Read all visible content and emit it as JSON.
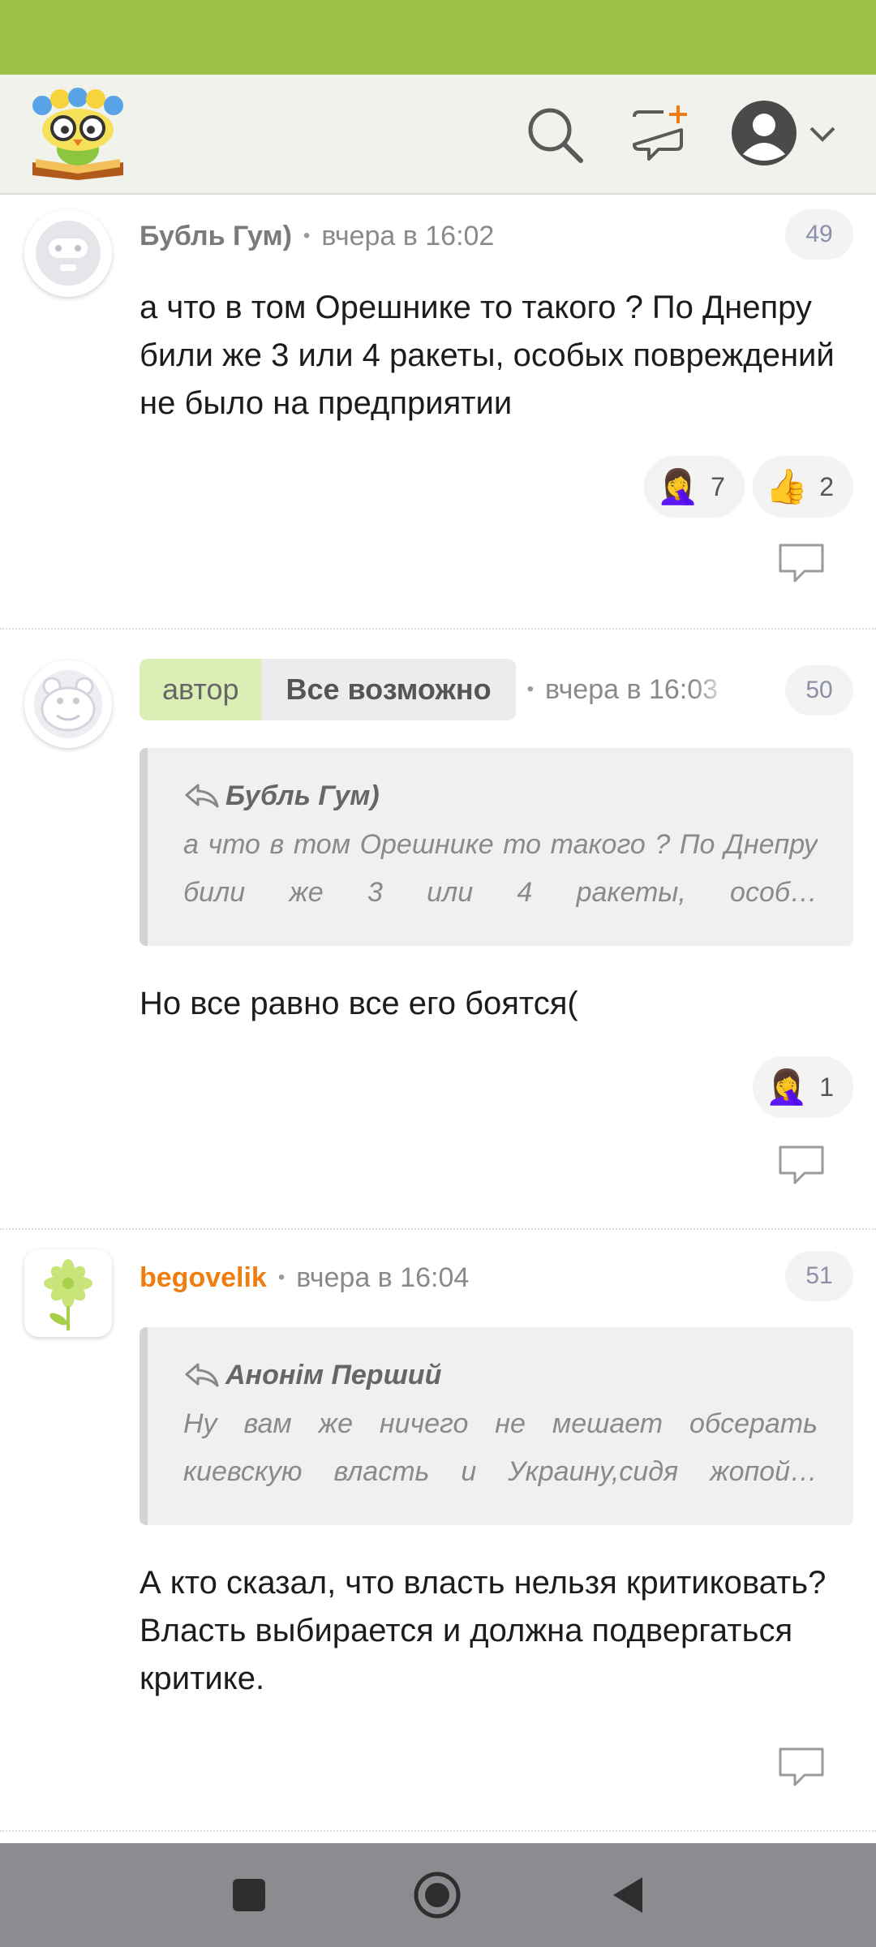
{
  "colors": {
    "status_bar": "#9dc146",
    "header_bg": "#f2f2ec",
    "accent_orange": "#f07d0f",
    "author_badge": "#dbeeb5",
    "nav_bar": "#8c8c90"
  },
  "header": {
    "logo_icon": "book-owl-logo-icon",
    "search_icon": "search-icon",
    "new_post_icon": "new-comment-icon",
    "profile_icon": "profile-avatar-icon",
    "menu_icon": "chevron-down-icon"
  },
  "comments": [
    {
      "author": "Бубль Гум)",
      "time": "вчера в 16:02",
      "number": "49",
      "avatar_icon": "robot-avatar-icon",
      "text": "а что в том Орешнике то такого ? По Днепру били же 3 или 4 ракеты, особых повреждений не было на предприятии",
      "reactions": [
        {
          "emoji": "🤦‍♀️",
          "count": "7"
        },
        {
          "emoji": "👍",
          "count": "2"
        }
      ]
    },
    {
      "badge_label": "автор",
      "author": "Все возможно",
      "time": "вчера в 16:03",
      "number": "50",
      "avatar_icon": "hippo-avatar-icon",
      "quote": {
        "author": "Бубль Гум)",
        "text": "а что в том Орешнике то такого ? По Днепру били же 3 или 4 ракеты, особ…"
      },
      "text": "Но все равно все его боятся(",
      "reactions": [
        {
          "emoji": "🤦‍♀️",
          "count": "1"
        }
      ]
    },
    {
      "author": "begovelik",
      "time": "вчера в 16:04",
      "number": "51",
      "avatar_icon": "flower-avatar-icon",
      "quote": {
        "author": "Анонім Перший",
        "text": "Ну вам же ничего не мешает обсерать киевскую власть и Украину,сидя жопой…"
      },
      "text": "А кто сказал, что власть нельзя критиковать? Власть выбирается и должна подвергаться критике."
    }
  ],
  "nav": {
    "recents_icon": "square-icon",
    "home_icon": "home-circle-icon",
    "back_icon": "back-triangle-icon"
  }
}
